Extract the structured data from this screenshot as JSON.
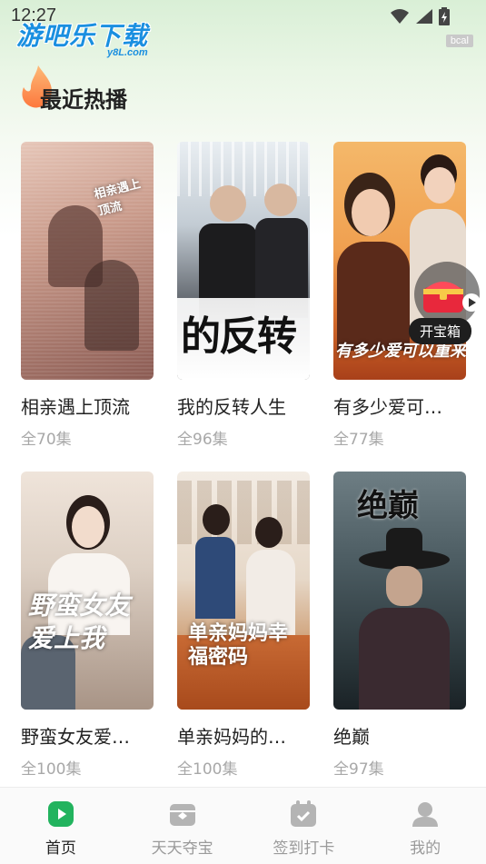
{
  "status_bar": {
    "time": "12:27"
  },
  "watermark": {
    "main": "游吧乐下载",
    "sub": "y8L.com",
    "badge": "bcal"
  },
  "section": {
    "title": "最近热播"
  },
  "dramas": [
    {
      "title": "相亲遇上顶流",
      "episodes": "全70集",
      "poster_text": "相亲遇上顶流",
      "colors": [
        "#d9b6a8",
        "#8a5a52"
      ]
    },
    {
      "title": "我的反转人生",
      "episodes": "全96集",
      "poster_text": "的反转",
      "colors": [
        "#c9d4de",
        "#2b2b2b"
      ]
    },
    {
      "title": "有多少爱可…",
      "episodes": "全77集",
      "poster_text": "有多少爱可以重来",
      "colors": [
        "#f2a04a",
        "#b04a20"
      ]
    },
    {
      "title": "野蛮女友爱…",
      "episodes": "全100集",
      "poster_text": "野蛮女友爱上我",
      "colors": [
        "#e9d8cc",
        "#7d6a5f"
      ]
    },
    {
      "title": "单亲妈妈的…",
      "episodes": "全100集",
      "poster_text": "单亲妈妈幸福密码",
      "colors": [
        "#f1e7dc",
        "#b85a2a"
      ]
    },
    {
      "title": "绝巅",
      "episodes": "全97集",
      "poster_text": "绝巅",
      "colors": [
        "#5a6a70",
        "#1f2a2e"
      ]
    }
  ],
  "treasure": {
    "label": "开宝箱"
  },
  "tabs": [
    {
      "label": "首页",
      "icon": "play-icon",
      "active": true
    },
    {
      "label": "天天夺宝",
      "icon": "treasure-icon",
      "active": false
    },
    {
      "label": "签到打卡",
      "icon": "calendar-check-icon",
      "active": false
    },
    {
      "label": "我的",
      "icon": "user-icon",
      "active": false
    }
  ],
  "colors": {
    "accent": "#22b35e",
    "tab_inactive": "#9a9a9a"
  }
}
